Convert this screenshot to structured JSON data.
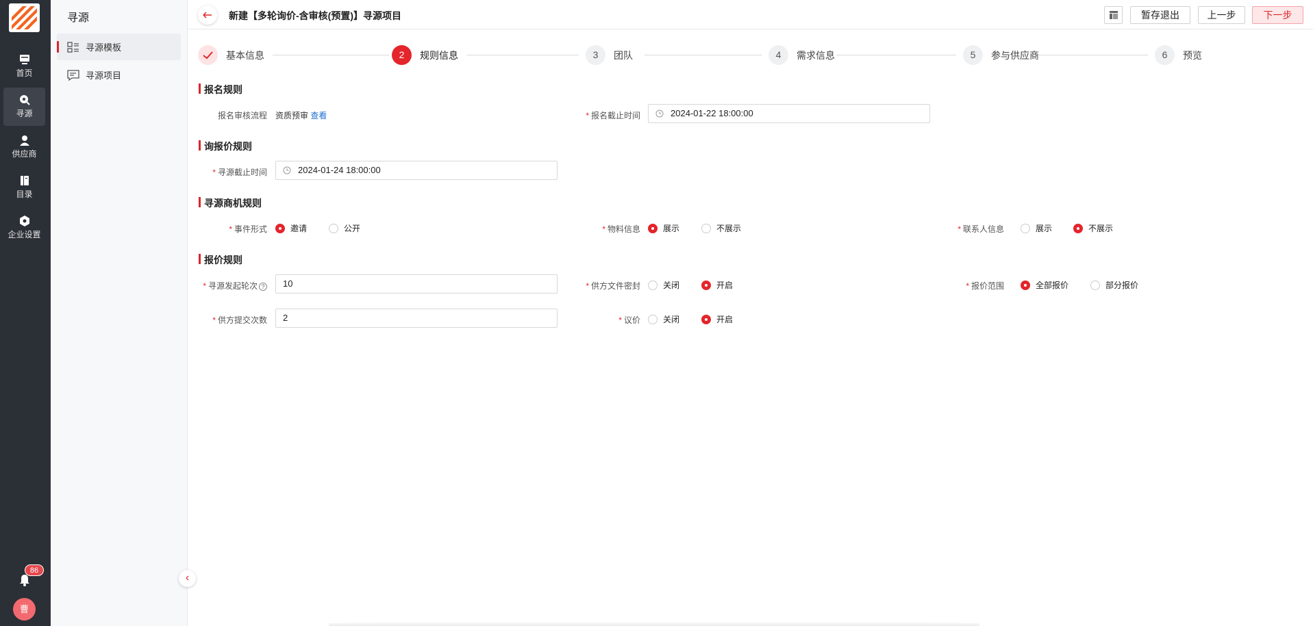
{
  "nav": {
    "items": [
      {
        "label": "首页",
        "icon": "monitor-icon"
      },
      {
        "label": "寻源",
        "icon": "sourcing-icon"
      },
      {
        "label": "供应商",
        "icon": "person-icon"
      },
      {
        "label": "目录",
        "icon": "catalog-icon"
      },
      {
        "label": "企业设置",
        "icon": "hexagon-settings-icon"
      }
    ],
    "notification_count": "86",
    "avatar_text": "曹"
  },
  "submenu": {
    "title": "寻源",
    "items": [
      {
        "label": "寻源模板",
        "icon": "template-list-icon"
      },
      {
        "label": "寻源项目",
        "icon": "chat-list-icon"
      }
    ]
  },
  "header": {
    "title": "新建【多轮询价-含审核(预置)】寻源项目",
    "save_exit": "暂存退出",
    "prev": "上一步",
    "next": "下一步"
  },
  "steps": [
    {
      "num": "1",
      "label": "基本信息",
      "state": "done"
    },
    {
      "num": "2",
      "label": "规则信息",
      "state": "current"
    },
    {
      "num": "3",
      "label": "团队",
      "state": "todo"
    },
    {
      "num": "4",
      "label": "需求信息",
      "state": "todo"
    },
    {
      "num": "5",
      "label": "参与供应商",
      "state": "todo"
    },
    {
      "num": "6",
      "label": "预览",
      "state": "todo"
    }
  ],
  "sections": {
    "signup": {
      "title": "报名规则",
      "review_flow_label": "报名审核流程",
      "review_flow_value": "资质预审",
      "review_flow_link": "查看",
      "deadline_label": "报名截止时间",
      "deadline_value": "2024-01-22 18:00:00"
    },
    "inquiry": {
      "title": "询报价规则",
      "deadline_label": "寻源截止时间",
      "deadline_value": "2024-01-24 18:00:00"
    },
    "opportunity": {
      "title": "寻源商机规则",
      "event_form_label": "事件形式",
      "event_form_options": [
        "邀请",
        "公开"
      ],
      "material_label": "物料信息",
      "material_options": [
        "展示",
        "不展示"
      ],
      "contact_label": "联系人信息",
      "contact_options": [
        "展示",
        "不展示"
      ]
    },
    "quote": {
      "title": "报价规则",
      "rounds_label": "寻源发起轮次",
      "rounds_value": "10",
      "seal_label": "供方文件密封",
      "seal_options": [
        "关闭",
        "开启"
      ],
      "scope_label": "报价范围",
      "scope_options": [
        "全部报价",
        "部分报价"
      ],
      "submit_count_label": "供方提交次数",
      "submit_count_value": "2",
      "negotiate_label": "议价",
      "negotiate_options": [
        "关闭",
        "开启"
      ]
    }
  }
}
